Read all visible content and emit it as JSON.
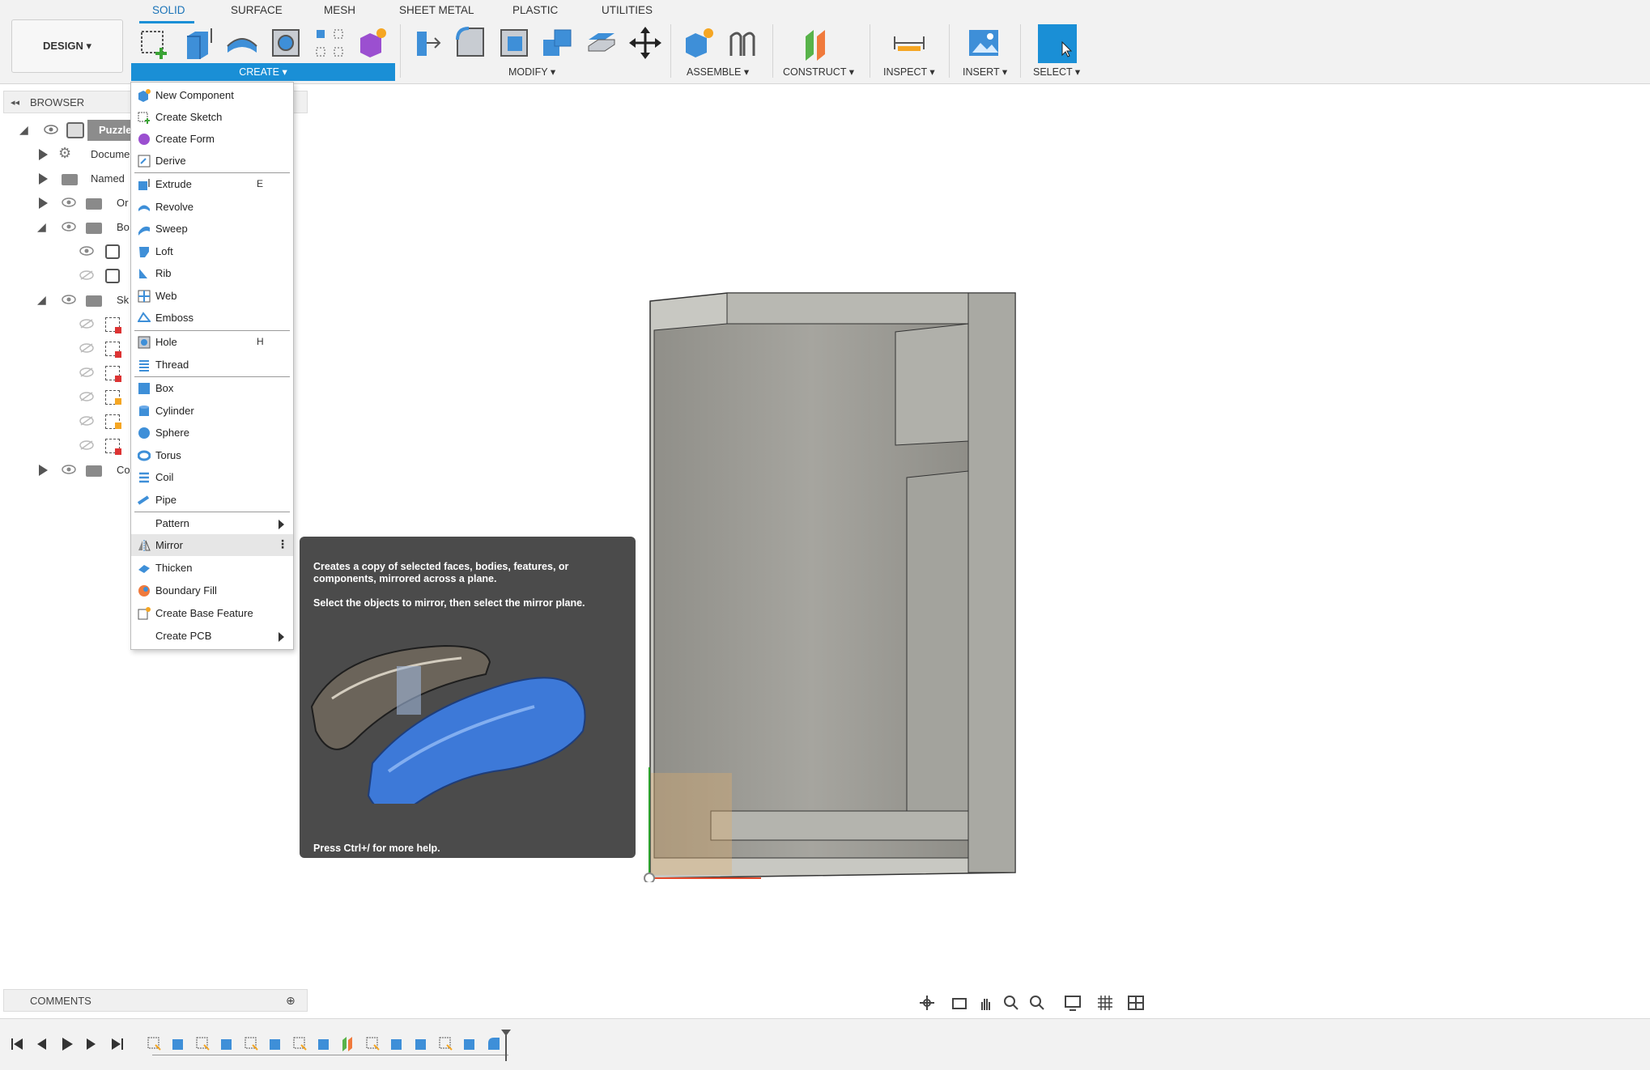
{
  "toolbar": {
    "workspace_label": "DESIGN ▾",
    "tabs": [
      "SOLID",
      "SURFACE",
      "MESH",
      "SHEET METAL",
      "PLASTIC",
      "UTILITIES"
    ],
    "groups": {
      "create": "CREATE ▾",
      "modify": "MODIFY ▾",
      "assemble": "ASSEMBLE ▾",
      "construct": "CONSTRUCT ▾",
      "inspect": "INSPECT ▾",
      "insert": "INSERT ▾",
      "select": "SELECT ▾"
    }
  },
  "browser": {
    "title": "BROWSER",
    "rows": [
      "Puzzle",
      "Docume",
      "Named",
      "Or",
      "Bo",
      "Sk",
      "Co"
    ]
  },
  "create_menu": {
    "items": [
      {
        "label": "New Component",
        "key": "",
        "icon": "new-component-icon"
      },
      {
        "label": "Create Sketch",
        "key": "",
        "icon": "create-sketch-icon"
      },
      {
        "label": "Create Form",
        "key": "",
        "icon": "create-form-icon"
      },
      {
        "label": "Derive",
        "key": "",
        "icon": "derive-icon"
      },
      {
        "label": "Extrude",
        "key": "E",
        "icon": "extrude-icon"
      },
      {
        "label": "Revolve",
        "key": "",
        "icon": "revolve-icon"
      },
      {
        "label": "Sweep",
        "key": "",
        "icon": "sweep-icon"
      },
      {
        "label": "Loft",
        "key": "",
        "icon": "loft-icon"
      },
      {
        "label": "Rib",
        "key": "",
        "icon": "rib-icon"
      },
      {
        "label": "Web",
        "key": "",
        "icon": "web-icon"
      },
      {
        "label": "Emboss",
        "key": "",
        "icon": "emboss-icon"
      },
      {
        "label": "Hole",
        "key": "H",
        "icon": "hole-icon"
      },
      {
        "label": "Thread",
        "key": "",
        "icon": "thread-icon"
      },
      {
        "label": "Box",
        "key": "",
        "icon": "box-icon"
      },
      {
        "label": "Cylinder",
        "key": "",
        "icon": "cylinder-icon"
      },
      {
        "label": "Sphere",
        "key": "",
        "icon": "sphere-icon"
      },
      {
        "label": "Torus",
        "key": "",
        "icon": "torus-icon"
      },
      {
        "label": "Coil",
        "key": "",
        "icon": "coil-icon"
      },
      {
        "label": "Pipe",
        "key": "",
        "icon": "pipe-icon"
      },
      {
        "label": "Pattern",
        "key": "",
        "icon": ""
      },
      {
        "label": "Mirror",
        "key": "",
        "icon": "mirror-icon"
      },
      {
        "label": "Thicken",
        "key": "",
        "icon": "thicken-icon"
      },
      {
        "label": "Boundary Fill",
        "key": "",
        "icon": "boundary-fill-icon"
      },
      {
        "label": "Create Base Feature",
        "key": "",
        "icon": "base-feature-icon"
      },
      {
        "label": "Create PCB",
        "key": "",
        "icon": ""
      }
    ]
  },
  "tooltip": {
    "description": "Creates a copy of selected faces, bodies, features, or components, mirrored across a plane.",
    "instruction": "Select the objects to mirror, then select the mirror plane.",
    "help": "Press Ctrl+/ for more help."
  },
  "comments": {
    "title": "COMMENTS"
  },
  "colors": {
    "accent": "#1a8fd6",
    "model_face": "#9e9d97",
    "tooltip_bg": "#4b4b4b"
  }
}
